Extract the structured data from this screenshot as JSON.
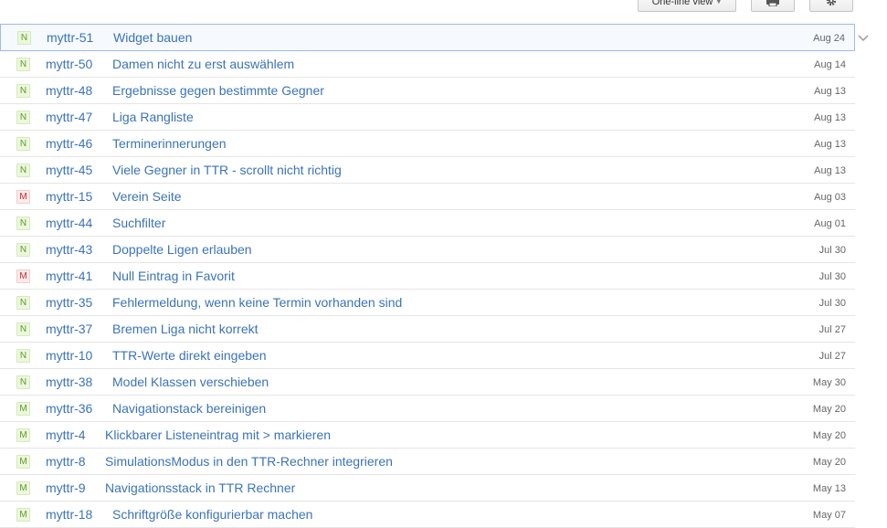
{
  "toolbar": {
    "view_label": "One-line view",
    "print_icon": "printer-icon",
    "settings_icon": "gear-icon"
  },
  "colors": {
    "link": "#3b73b9",
    "badge_green_text": "#5c9a2b",
    "badge_red_text": "#c62a2a",
    "selected_border": "#9ebaf0"
  },
  "issues": [
    {
      "type": "N",
      "color": "green",
      "key": "myttr-51",
      "title": "Widget bauen",
      "date": "Aug 24",
      "selected": true
    },
    {
      "type": "N",
      "color": "green",
      "key": "myttr-50",
      "title": "Damen nicht zu erst auswählem",
      "date": "Aug 14"
    },
    {
      "type": "N",
      "color": "green",
      "key": "myttr-48",
      "title": "Ergebnisse gegen bestimmte Gegner",
      "date": "Aug 13"
    },
    {
      "type": "N",
      "color": "green",
      "key": "myttr-47",
      "title": "Liga Rangliste",
      "date": "Aug 13"
    },
    {
      "type": "N",
      "color": "green",
      "key": "myttr-46",
      "title": "Terminerinnerungen",
      "date": "Aug 13"
    },
    {
      "type": "N",
      "color": "green",
      "key": "myttr-45",
      "title": "Viele Gegner in TTR - scrollt nicht richtig",
      "date": "Aug 13"
    },
    {
      "type": "M",
      "color": "red",
      "key": "myttr-15",
      "title": "Verein Seite",
      "date": "Aug 03"
    },
    {
      "type": "N",
      "color": "green",
      "key": "myttr-44",
      "title": "Suchfilter",
      "date": "Aug 01"
    },
    {
      "type": "N",
      "color": "green",
      "key": "myttr-43",
      "title": "Doppelte Ligen erlauben",
      "date": "Jul 30"
    },
    {
      "type": "M",
      "color": "red",
      "key": "myttr-41",
      "title": "Null Eintrag in Favorit",
      "date": "Jul 30"
    },
    {
      "type": "N",
      "color": "green",
      "key": "myttr-35",
      "title": "Fehlermeldung, wenn keine Termin vorhanden sind",
      "date": "Jul 30"
    },
    {
      "type": "N",
      "color": "green",
      "key": "myttr-37",
      "title": "Bremen Liga nicht korrekt",
      "date": "Jul 27"
    },
    {
      "type": "N",
      "color": "green",
      "key": "myttr-10",
      "title": "TTR-Werte direkt eingeben",
      "date": "Jul 27"
    },
    {
      "type": "N",
      "color": "green",
      "key": "myttr-38",
      "title": "Model Klassen verschieben",
      "date": "May 30"
    },
    {
      "type": "M",
      "color": "green",
      "key": "myttr-36",
      "title": "Navigationstack bereinigen",
      "date": "May 20"
    },
    {
      "type": "M",
      "color": "green",
      "key": "myttr-4",
      "title": "Klickbarer Listeneintrag mit > markieren",
      "date": "May 20"
    },
    {
      "type": "M",
      "color": "green",
      "key": "myttr-8",
      "title": "SimulationsModus in den TTR-Rechner integrieren",
      "date": "May 20"
    },
    {
      "type": "M",
      "color": "green",
      "key": "myttr-9",
      "title": "Navigationsstack in TTR Rechner",
      "date": "May 13"
    },
    {
      "type": "M",
      "color": "green",
      "key": "myttr-18",
      "title": "Schriftgröße konfigurierbar machen",
      "date": "May 07"
    }
  ]
}
